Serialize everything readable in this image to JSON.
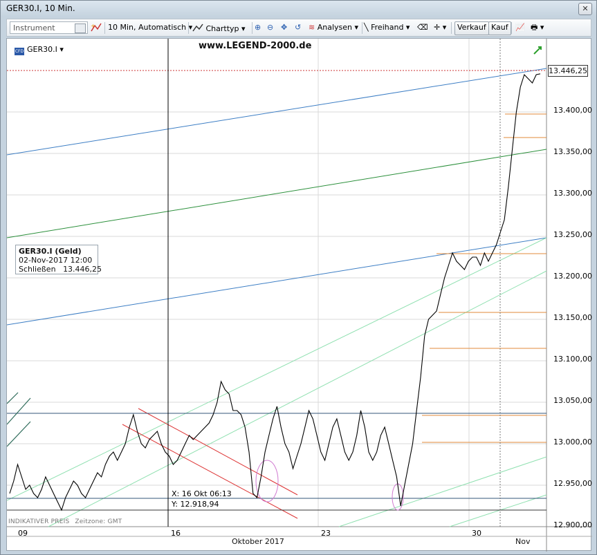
{
  "window": {
    "title": "GER30.I, 10 Min.",
    "close_label": "✕"
  },
  "toolbar": {
    "instrument_placeholder": "Instrument",
    "interval": "10 Min,",
    "mode": "Automatisch",
    "charttype": "Charttyp",
    "analysen": "Analysen",
    "freihand": "Freihand",
    "verkauf": "Verkauf",
    "kauf": "Kauf"
  },
  "chart": {
    "symbol": "GER30.I",
    "watermark": "www.LEGEND-2000.de",
    "last_price": "13.446,25",
    "info": {
      "title": "GER30.I (Geld)",
      "datetime": "02-Nov-2017 12:00",
      "close_label": "Schließen",
      "close_value": "13.446,25"
    },
    "crosshair": {
      "x": "X: 16 Okt 06:13",
      "y": "Y: 12.918,94"
    },
    "footer": {
      "left": "INDIKATIVER PREIS",
      "zone": "Zeitzone: GMT"
    },
    "month_label": "Oktober 2017",
    "month2_label": "Nov"
  },
  "chart_data": {
    "type": "line",
    "title": "GER30.I, 10 Min.",
    "y_ticks": [
      "13.446,25",
      "13.400,00",
      "13.350,00",
      "13.300,00",
      "13.250,00",
      "13.200,00",
      "13.150,00",
      "13.100,00",
      "13.050,00",
      "13.000,00",
      "12.950,00",
      "12.900,00"
    ],
    "x_ticks": [
      "09",
      "16",
      "23",
      "30"
    ],
    "ylim": [
      12900,
      13450
    ],
    "series": [
      {
        "values": [
          12940,
          12955,
          12975,
          12960,
          12945,
          12950,
          12940,
          12935,
          12945,
          12960,
          12950,
          12940,
          12930,
          12920,
          12935,
          12945,
          12955,
          12950,
          12940,
          12935,
          12945,
          12955,
          12965,
          12960,
          12975,
          12985,
          12990,
          12980,
          12990,
          13000,
          13020,
          13035,
          13015,
          13000,
          12995,
          13005,
          13010,
          13015,
          13000,
          12990,
          12985,
          12975,
          12980,
          12990,
          13000,
          13010,
          13005,
          13010,
          13015,
          13020,
          13025,
          13035,
          13050,
          13075,
          13065,
          13060,
          13040,
          13040,
          13035,
          13020,
          12990,
          12940,
          12935,
          12960,
          12990,
          13010,
          13030,
          13045,
          13020,
          13000,
          12990,
          12970,
          12985,
          13000,
          13020,
          13040,
          13030,
          13010,
          12990,
          12980,
          13000,
          13020,
          13030,
          13010,
          12990,
          12980,
          12990,
          13010,
          13040,
          13020,
          12990,
          12980,
          12990,
          13010,
          13020,
          13000,
          12980,
          12960,
          12925,
          12950,
          12975,
          13000,
          13040,
          13080,
          13130,
          13150,
          13155,
          13160,
          13180,
          13200,
          13215,
          13230,
          13220,
          13215,
          13210,
          13220,
          13225,
          13225,
          13215,
          13230,
          13220,
          13230,
          13240,
          13255,
          13270,
          13310,
          13355,
          13400,
          13430,
          13445,
          13440,
          13435,
          13445,
          13446
        ]
      }
    ]
  }
}
